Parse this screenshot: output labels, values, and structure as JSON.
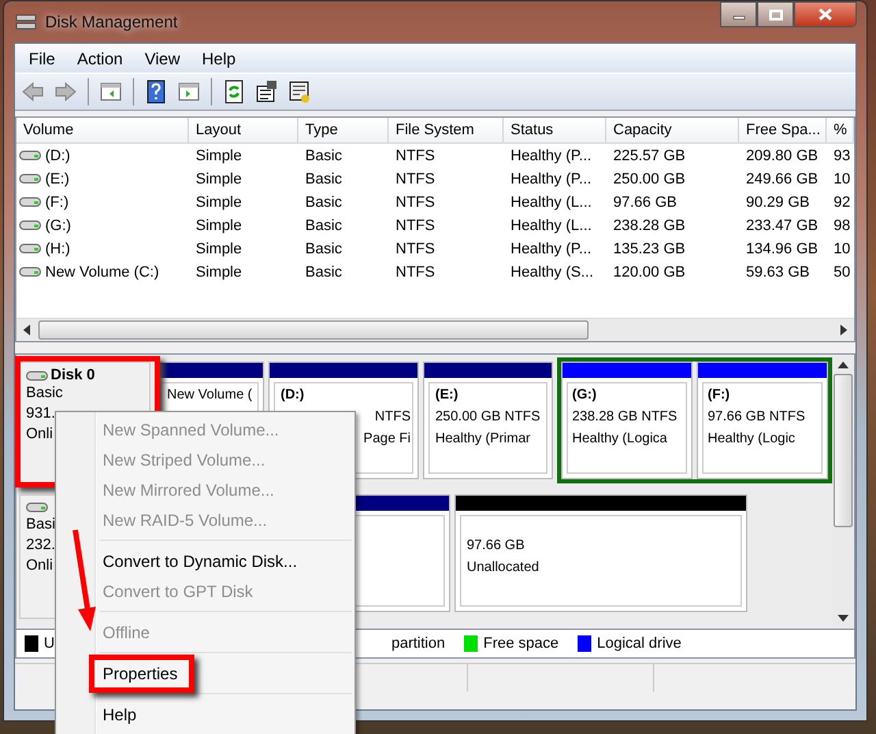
{
  "window": {
    "title": "Disk Management"
  },
  "menu_bar": [
    {
      "label": "File"
    },
    {
      "label": "Action"
    },
    {
      "label": "View"
    },
    {
      "label": "Help"
    }
  ],
  "volume_table": {
    "columns": [
      "Volume",
      "Layout",
      "Type",
      "File System",
      "Status",
      "Capacity",
      "Free Spa...",
      "%"
    ],
    "rows": [
      [
        "(D:)",
        "Simple",
        "Basic",
        "NTFS",
        "Healthy (P...",
        "225.57 GB",
        "209.80 GB",
        "93"
      ],
      [
        "(E:)",
        "Simple",
        "Basic",
        "NTFS",
        "Healthy (P...",
        "250.00 GB",
        "249.66 GB",
        "10"
      ],
      [
        "(F:)",
        "Simple",
        "Basic",
        "NTFS",
        "Healthy (L...",
        "97.66 GB",
        "90.29 GB",
        "92"
      ],
      [
        "(G:)",
        "Simple",
        "Basic",
        "NTFS",
        "Healthy (L...",
        "238.28 GB",
        "233.47 GB",
        "98"
      ],
      [
        "(H:)",
        "Simple",
        "Basic",
        "NTFS",
        "Healthy (P...",
        "135.23 GB",
        "134.96 GB",
        "10"
      ],
      [
        "New Volume (C:)",
        "Simple",
        "Basic",
        "NTFS",
        "Healthy (S...",
        "120.00 GB",
        "59.63 GB",
        "50"
      ]
    ]
  },
  "disks": [
    {
      "name": "Disk 0",
      "lines": [
        "Basic",
        "931.",
        "Onli"
      ],
      "highlighted": true,
      "partitions": [
        {
          "kind": "partition",
          "color": "#000080",
          "lines": [
            "New Volume ("
          ]
        },
        {
          "kind": "partition",
          "color": "#000080",
          "lines": [
            "(D:)",
            "NTFS",
            "Page Fi"
          ]
        },
        {
          "kind": "partition",
          "color": "#000080",
          "lines": [
            "(E:)",
            "250.00 GB NTFS",
            "Healthy (Primar"
          ]
        },
        {
          "kind": "extended",
          "children": [
            {
              "kind": "partition",
              "color": "#0000ff",
              "lines": [
                "(G:)",
                "238.28 GB NTFS",
                "Healthy (Logica"
              ]
            },
            {
              "kind": "partition",
              "color": "#0000ff",
              "lines": [
                "(F:)",
                "97.66 GB NTFS",
                "Healthy (Logic"
              ]
            }
          ]
        }
      ]
    },
    {
      "lines": [
        "Basi",
        "232.",
        "Onli"
      ],
      "highlighted": false,
      "partitions": [
        {
          "kind": "partition",
          "color": "#000080"
        },
        {
          "kind": "partition",
          "color": "#000000",
          "lines": [
            "97.66 GB",
            "Unallocated"
          ]
        }
      ]
    }
  ],
  "legend": [
    {
      "label": "U",
      "color": "#000000"
    },
    {
      "label": "partition"
    },
    {
      "label": "Free space",
      "color": "#00e000"
    },
    {
      "label": "Logical drive",
      "color": "#0000ff"
    }
  ],
  "context_menu": [
    {
      "label": "New Spanned Volume...",
      "disabled": true,
      "highlighted": false
    },
    {
      "label": "New Striped Volume...",
      "disabled": true,
      "highlighted": false
    },
    {
      "label": "New Mirrored Volume...",
      "disabled": true,
      "highlighted": false
    },
    {
      "label": "New RAID-5 Volume...",
      "disabled": true,
      "highlighted": false,
      "separator_after": true
    },
    {
      "label": "Convert to Dynamic Disk...",
      "disabled": false,
      "highlighted": false
    },
    {
      "label": "Convert to GPT Disk",
      "disabled": true,
      "highlighted": false,
      "separator_after": true
    },
    {
      "label": "Offline",
      "disabled": true,
      "highlighted": false,
      "separator_after": true
    },
    {
      "label": "Properties",
      "disabled": false,
      "highlighted": true,
      "separator_after": true
    },
    {
      "label": "Help",
      "disabled": false,
      "highlighted": false
    }
  ]
}
